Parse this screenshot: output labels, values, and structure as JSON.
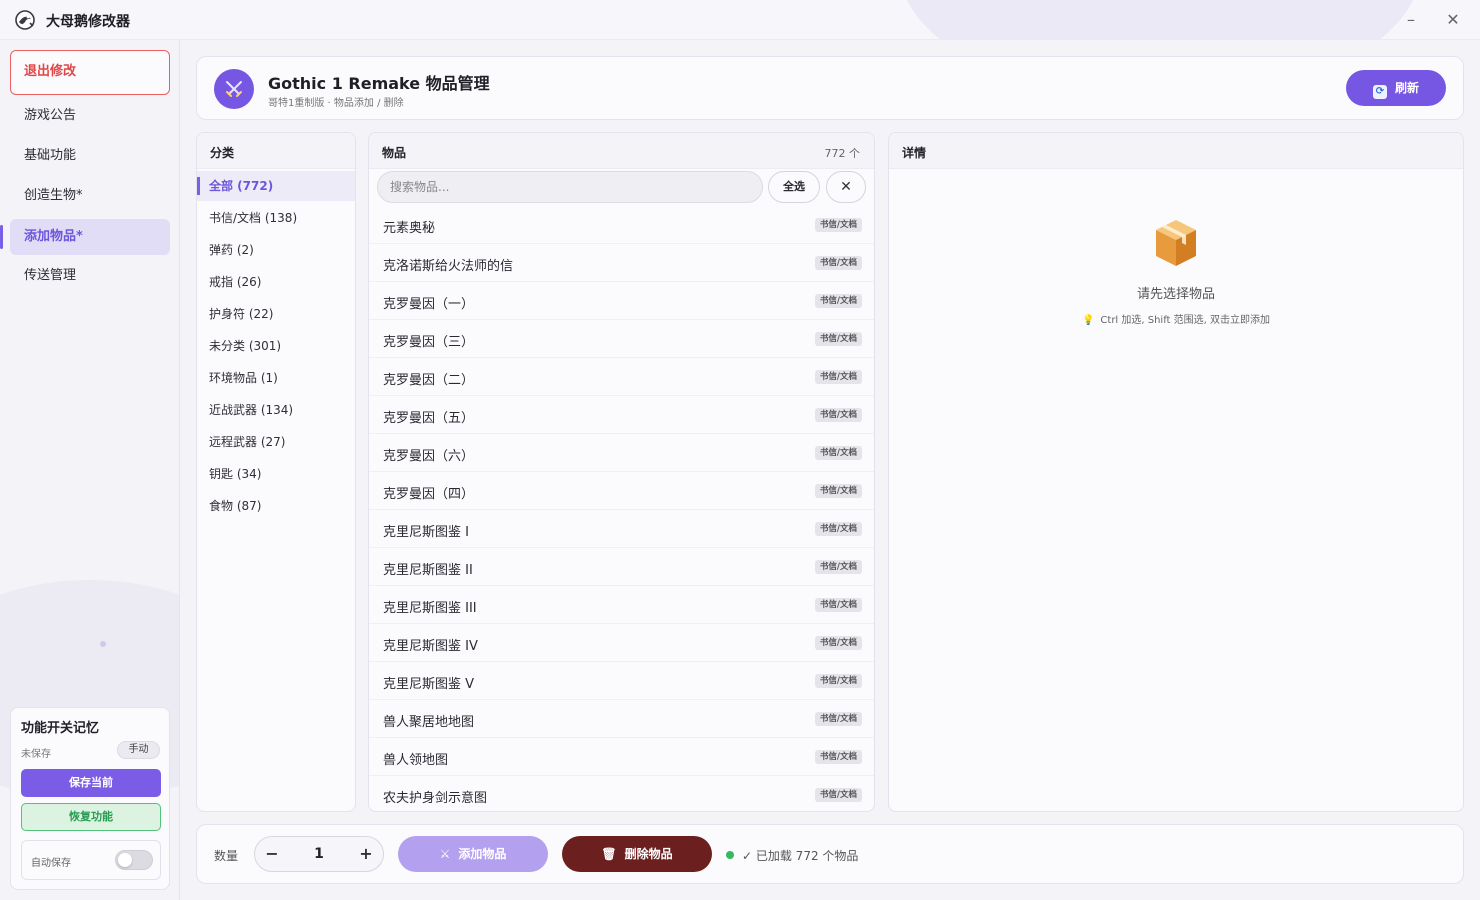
{
  "app": {
    "title": "大母鹅修改器",
    "minimize_glyph": "–",
    "close_glyph": "✕"
  },
  "colors": {
    "accent": "#7657e3",
    "danger": "#e04848",
    "success": "#35b860",
    "delete_button": "#6b1f1f"
  },
  "sidebar": {
    "exit_label": "退出修改",
    "items": [
      {
        "label": "游戏公告",
        "active": false
      },
      {
        "label": "基础功能",
        "active": false
      },
      {
        "label": "创造生物*",
        "active": false
      },
      {
        "label": "添加物品*",
        "active": true
      },
      {
        "label": "传送管理",
        "active": false
      }
    ],
    "memory": {
      "title": "功能开关记忆",
      "status": "未保存",
      "mode": "手动",
      "save_label": "保存当前",
      "restore_label": "恢复功能",
      "auto_save_label": "自动保存",
      "auto_save_on": false
    }
  },
  "header": {
    "title": "Gothic 1 Remake 物品管理",
    "subtitle": "哥特1重制版 · 物品添加 / 删除",
    "refresh_label": "刷新",
    "icon": "crossed-swords-icon"
  },
  "categories": {
    "title": "分类",
    "items": [
      {
        "label": "全部 (772)",
        "active": true
      },
      {
        "label": "书信/文档 (138)",
        "active": false
      },
      {
        "label": "弹药 (2)",
        "active": false
      },
      {
        "label": "戒指 (26)",
        "active": false
      },
      {
        "label": "护身符 (22)",
        "active": false
      },
      {
        "label": "未分类 (301)",
        "active": false
      },
      {
        "label": "环境物品 (1)",
        "active": false
      },
      {
        "label": "近战武器 (134)",
        "active": false
      },
      {
        "label": "远程武器 (27)",
        "active": false
      },
      {
        "label": "钥匙 (34)",
        "active": false
      },
      {
        "label": "食物 (87)",
        "active": false
      }
    ]
  },
  "items_panel": {
    "title": "物品",
    "count": "772 个",
    "search_placeholder": "搜索物品...",
    "select_all_label": "全选",
    "clear_glyph": "✕",
    "items": [
      {
        "name": "元素奥秘",
        "tag": "书信/文档"
      },
      {
        "name": "克洛诺斯给火法师的信",
        "tag": "书信/文档"
      },
      {
        "name": "克罗曼因（一）",
        "tag": "书信/文档"
      },
      {
        "name": "克罗曼因（三）",
        "tag": "书信/文档"
      },
      {
        "name": "克罗曼因（二）",
        "tag": "书信/文档"
      },
      {
        "name": "克罗曼因（五）",
        "tag": "书信/文档"
      },
      {
        "name": "克罗曼因（六）",
        "tag": "书信/文档"
      },
      {
        "name": "克罗曼因（四）",
        "tag": "书信/文档"
      },
      {
        "name": "克里尼斯图鉴 I",
        "tag": "书信/文档"
      },
      {
        "name": "克里尼斯图鉴 II",
        "tag": "书信/文档"
      },
      {
        "name": "克里尼斯图鉴 III",
        "tag": "书信/文档"
      },
      {
        "name": "克里尼斯图鉴 IV",
        "tag": "书信/文档"
      },
      {
        "name": "克里尼斯图鉴 V",
        "tag": "书信/文档"
      },
      {
        "name": "兽人聚居地地图",
        "tag": "书信/文档"
      },
      {
        "name": "兽人领地图",
        "tag": "书信/文档"
      },
      {
        "name": "农夫护身剑示意图",
        "tag": "书信/文档"
      }
    ]
  },
  "detail": {
    "title": "详情",
    "empty_title": "请先选择物品",
    "empty_hint": "Ctrl 加选, Shift 范围选, 双击立即添加",
    "empty_icon": "package-box-icon"
  },
  "bottom": {
    "qty_label": "数量",
    "qty_value": "1",
    "minus_glyph": "−",
    "plus_glyph": "+",
    "add_label": "添加物品",
    "delete_label": "删除物品",
    "status": "✓ 已加载 772 个物品"
  }
}
